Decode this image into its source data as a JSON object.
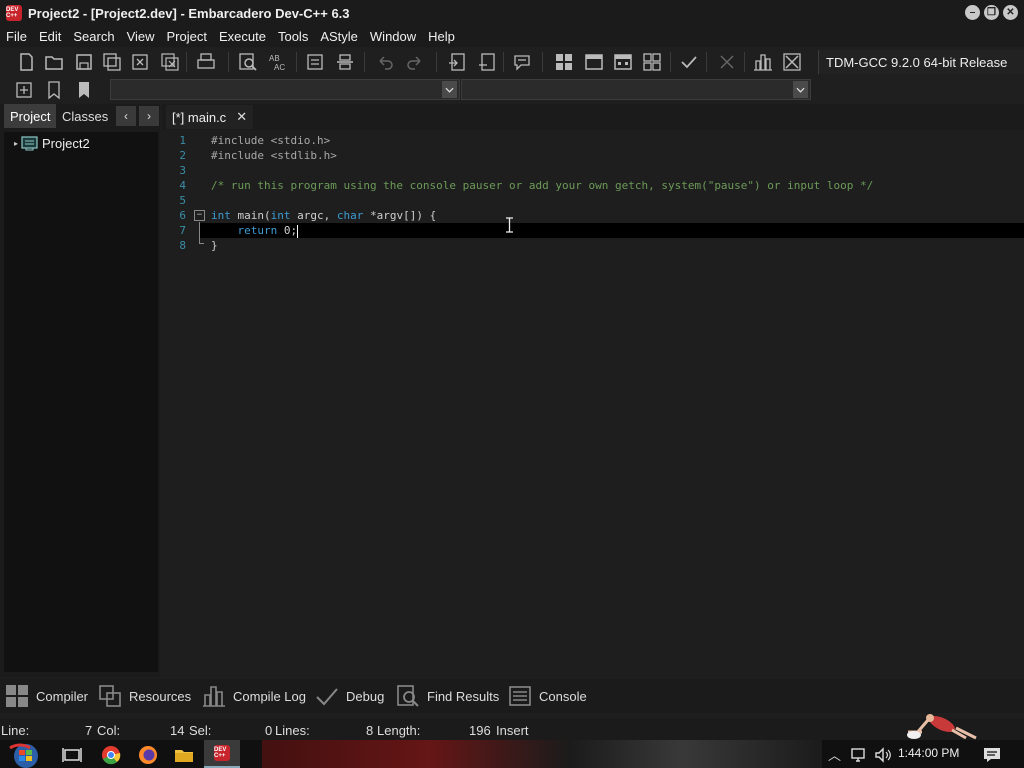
{
  "window": {
    "title": "Project2 - [Project2.dev] - Embarcadero Dev-C++ 6.3",
    "logo_text": "DEV C++"
  },
  "menu": [
    "File",
    "Edit",
    "Search",
    "View",
    "Project",
    "Execute",
    "Tools",
    "AStyle",
    "Window",
    "Help"
  ],
  "toolbar": {
    "compiler": "TDM-GCC 9.2.0 64-bit Release"
  },
  "left_panel": {
    "tabs": [
      "Project",
      "Classes"
    ],
    "active_tab": "Project",
    "tree_root": "Project2"
  },
  "editor": {
    "tab_label": "[*] main.c",
    "tab_close": "✕",
    "line_numbers": [
      "1",
      "2",
      "3",
      "4",
      "5",
      "6",
      "7",
      "8"
    ],
    "current_line": 7
  },
  "bottom_tabs": [
    "Compiler",
    "Resources",
    "Compile Log",
    "Debug",
    "Find Results",
    "Console"
  ],
  "status": {
    "line_label": "Line:",
    "line": "7",
    "col_label": "Col:",
    "col": "14",
    "sel_label": "Sel:",
    "sel": "0",
    "lines_label": "Lines:",
    "lines": "8",
    "length_label": "Length:",
    "length": "196",
    "mode": "Insert"
  },
  "taskbar": {
    "time": "1:44:00 PM"
  },
  "colors": {
    "keyword": "#3d9bd0",
    "comment": "#6c9a58",
    "line_number": "#3b8ea8",
    "background": "#1e1e1e"
  },
  "icons": [
    "new-file-icon",
    "open-icon",
    "save-icon",
    "save-all-icon",
    "close-icon",
    "close-all-icon",
    "print-icon",
    "find-icon",
    "replace-icon",
    "indent-icon",
    "unindent-icon",
    "undo-icon",
    "redo-icon",
    "goto-icon",
    "compile-icon",
    "run-icon",
    "compile-run-icon",
    "rebuild-icon",
    "syntax-check-icon",
    "stop-icon",
    "chart-icon",
    "debug-stop-icon"
  ]
}
